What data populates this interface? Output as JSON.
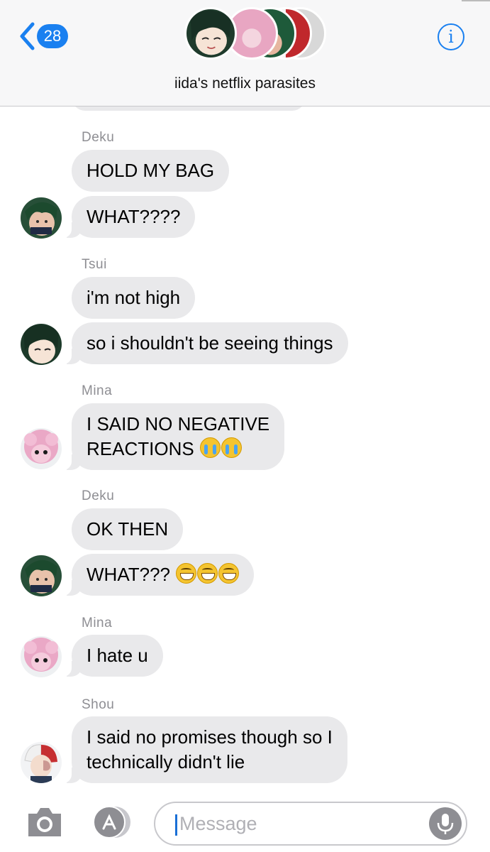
{
  "header": {
    "back_count": "28",
    "group_name": "iida's netflix parasites",
    "info_label": "i"
  },
  "messages": [
    {
      "sender": "Deku",
      "bubbles": [
        "HOLD MY BAG",
        "WHAT????"
      ],
      "avatar": "deku-avatar"
    },
    {
      "sender": "Tsui",
      "bubbles": [
        "i'm not high",
        "so i shouldn't be seeing things"
      ],
      "avatar": "tsui-avatar"
    },
    {
      "sender": "Mina",
      "bubbles": [
        "I SAID NO NEGATIVE",
        "REACTIONS"
      ],
      "emoji": [
        "loudly-crying-face",
        "loudly-crying-face"
      ],
      "avatar": "mina-avatar"
    },
    {
      "sender": "Deku",
      "bubbles": [
        "OK THEN",
        "WHAT???"
      ],
      "emoji": [
        "grinning-face",
        "grinning-face",
        "grinning-face"
      ],
      "avatar": "deku-avatar"
    },
    {
      "sender": "Mina",
      "bubbles": [
        "I hate u"
      ],
      "avatar": "mina-avatar"
    },
    {
      "sender": "Shou",
      "bubbles": [
        "I said no promises though so I",
        "technically didn't lie"
      ],
      "avatar": "shou-avatar"
    }
  ],
  "input": {
    "placeholder": "Message",
    "icons": [
      "camera-icon",
      "app-store-icon",
      "microphone-icon"
    ]
  },
  "colors": {
    "accent": "#1a80f0",
    "bubble_gray": "#e9e9eb",
    "header_bg": "#f7f7f8"
  }
}
